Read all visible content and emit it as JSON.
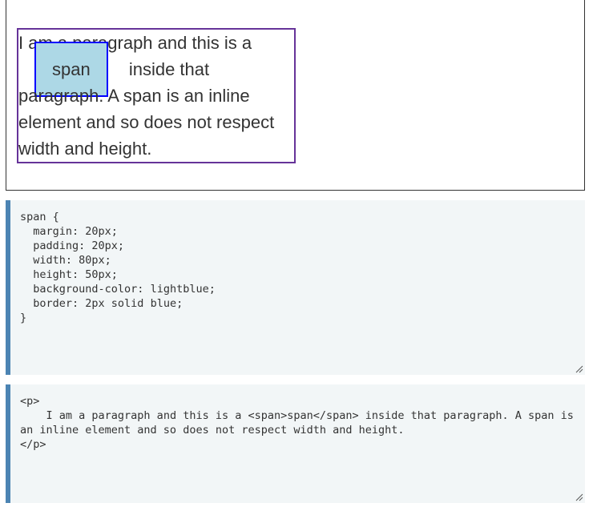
{
  "preview": {
    "paragraph_before": "I am a paragraph and this is a ",
    "span_text": "span",
    "paragraph_after": " inside that paragraph. A span is an inline element and so does not respect width and height."
  },
  "css_editor": {
    "code": "span {\n  margin: 20px;\n  padding: 20px;\n  width: 80px;\n  height: 50px;\n  background-color: lightblue;\n  border: 2px solid blue;\n}"
  },
  "html_editor": {
    "code": "<p>\n    I am a paragraph and this is a <span>span</span> inside that paragraph. A span is an inline element and so does not respect width and height.\n</p>"
  },
  "colors": {
    "editor_background": "#f2f6f7",
    "editor_accent": "#4c84b3",
    "paragraph_border": "rebeccapurple",
    "span_background": "lightblue",
    "span_border": "blue"
  }
}
